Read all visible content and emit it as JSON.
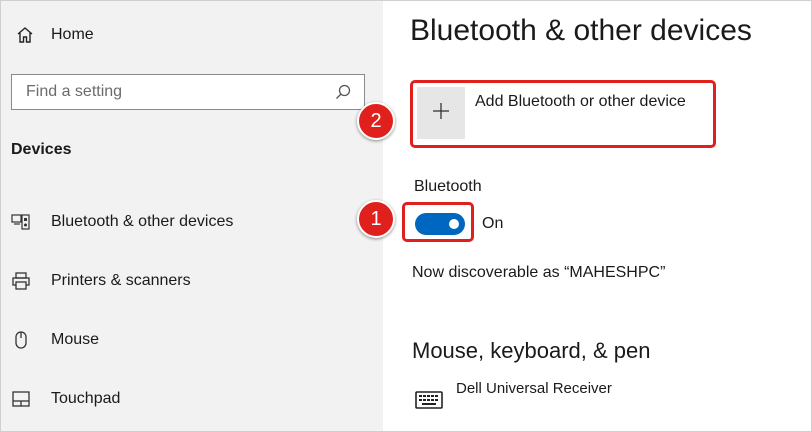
{
  "sidebar": {
    "home_label": "Home",
    "search": {
      "placeholder": "Find a setting"
    },
    "section_title": "Devices",
    "items": [
      {
        "label": "Bluetooth & other devices",
        "icon": "bluetooth-devices-icon"
      },
      {
        "label": "Printers & scanners",
        "icon": "printer-icon"
      },
      {
        "label": "Mouse",
        "icon": "mouse-icon"
      },
      {
        "label": "Touchpad",
        "icon": "touchpad-icon"
      }
    ]
  },
  "main": {
    "title": "Bluetooth & other devices",
    "add_device_label": "Add Bluetooth or other device",
    "bluetooth_label": "Bluetooth",
    "bluetooth_state": "On",
    "discoverable_text": "Now discoverable as “MAHESHPC”",
    "subheading": "Mouse, keyboard, & pen",
    "device_name": "Dell Universal Receiver"
  },
  "annotations": {
    "badge_1": "1",
    "badge_2": "2"
  },
  "colors": {
    "highlight": "#e0201c",
    "toggle_on": "#0067c0",
    "sidebar_bg": "#f2f2f2"
  }
}
